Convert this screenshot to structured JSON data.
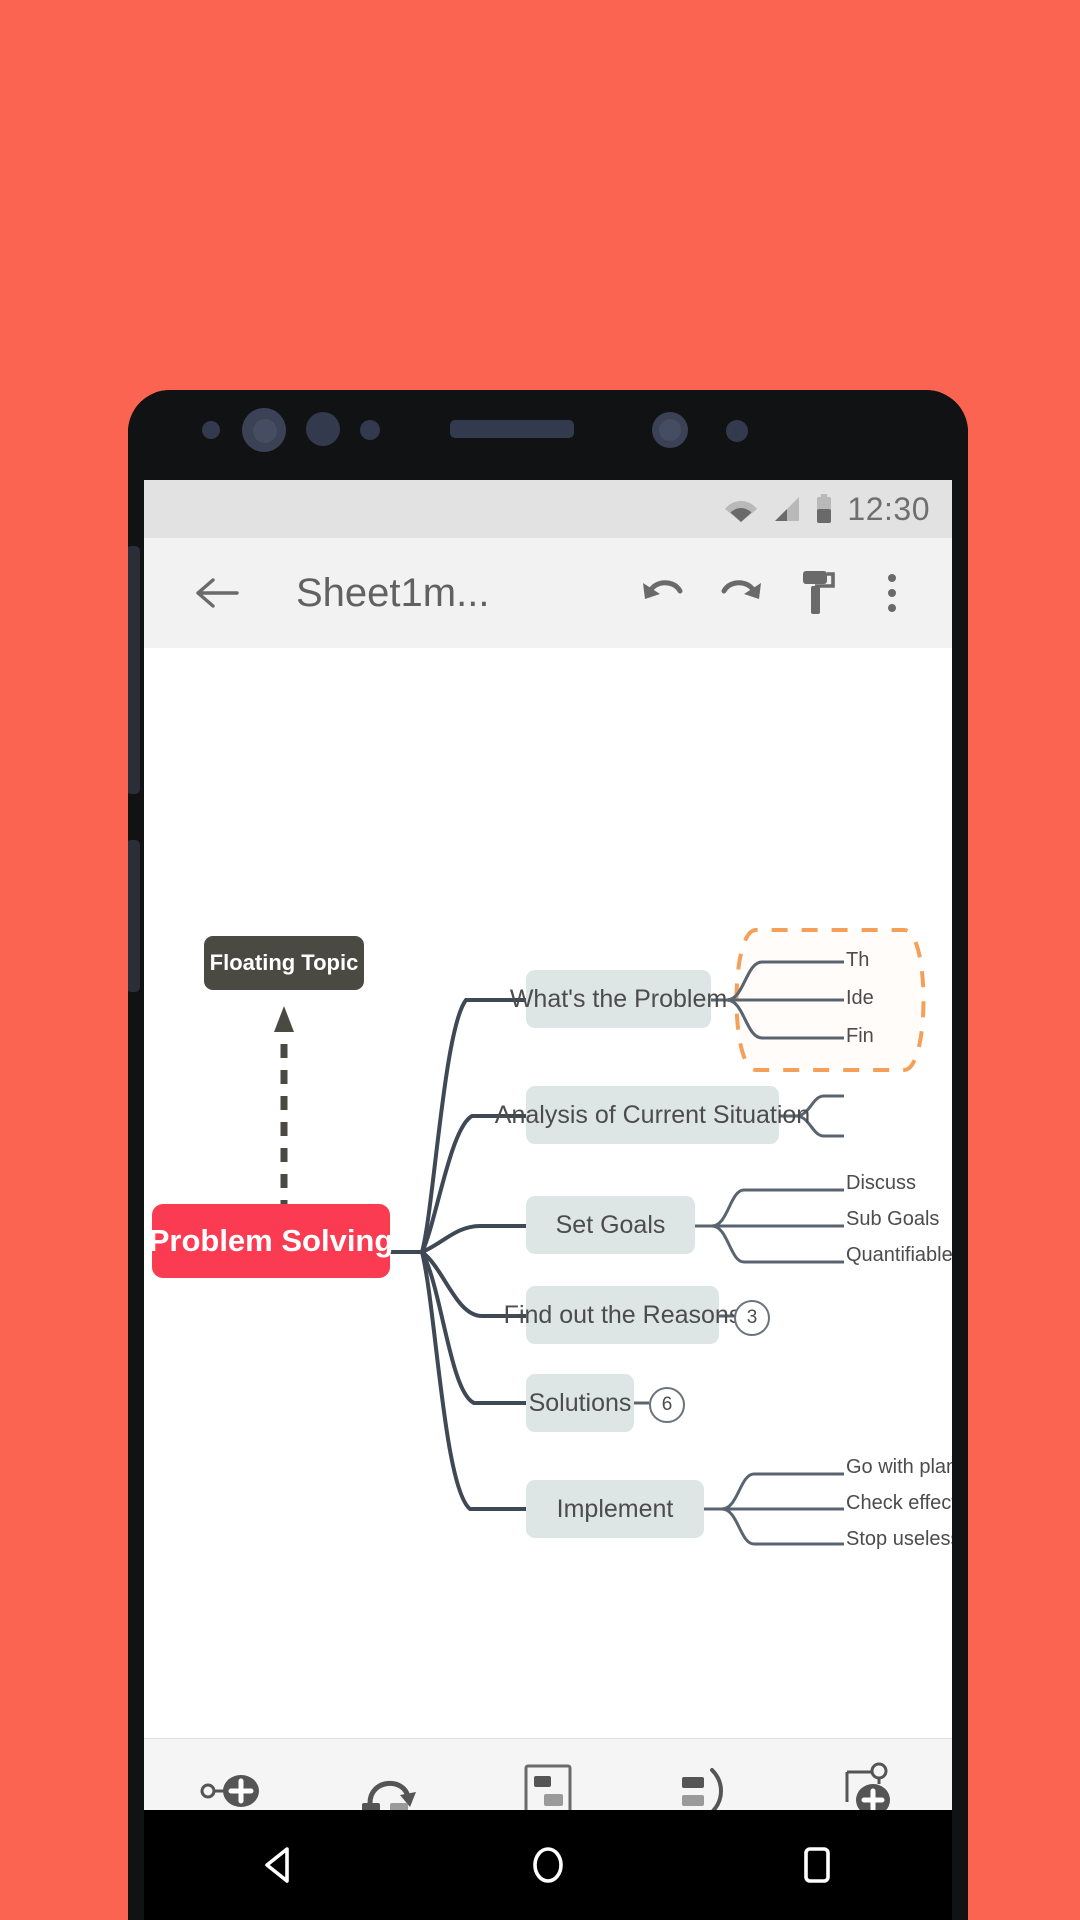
{
  "background_color": "#fb6450",
  "status_bar": {
    "time": "12:30",
    "icons": [
      "wifi-icon",
      "cellular-signal-icon",
      "battery-icon"
    ]
  },
  "toolbar": {
    "back_label": "←",
    "title": "Sheet1m...",
    "undo_label": "undo-icon",
    "redo_label": "redo-icon",
    "format_label": "format-painter-icon",
    "overflow_label": "more-options-icon"
  },
  "mindmap": {
    "central": {
      "label": "Problem Solving",
      "color": "#fb3b51"
    },
    "floating": {
      "label": "Floating Topic",
      "color": "#4b4a42"
    },
    "branch_color": "#dde5e5",
    "boundary_color": "#f5a05a",
    "branches": [
      {
        "label": "What's the Problem",
        "children": [
          "Th",
          "Ide",
          "Fin"
        ],
        "badge": null
      },
      {
        "label": "Analysis of Current Situation",
        "children": [],
        "badge": null
      },
      {
        "label": "Set Goals",
        "children": [
          "Discuss",
          "Sub Goals",
          "Quantifiable targe"
        ],
        "badge": null
      },
      {
        "label": "Find out the Reasons",
        "children": [],
        "badge": "3"
      },
      {
        "label": "Solutions",
        "children": [],
        "badge": "6"
      },
      {
        "label": "Implement",
        "children": [
          "Go with plans",
          "Check effect of",
          "Stop useless so"
        ],
        "badge": null
      }
    ]
  },
  "bottom_toolbar": {
    "items": [
      {
        "name": "add-sibling-topic-button"
      },
      {
        "name": "add-relationship-button"
      },
      {
        "name": "add-boundary-button"
      },
      {
        "name": "add-summary-button"
      },
      {
        "name": "add-floating-topic-button"
      }
    ]
  },
  "nav_bar": {
    "back": "back-triangle-icon",
    "home": "home-circle-icon",
    "recents": "recents-square-icon"
  }
}
